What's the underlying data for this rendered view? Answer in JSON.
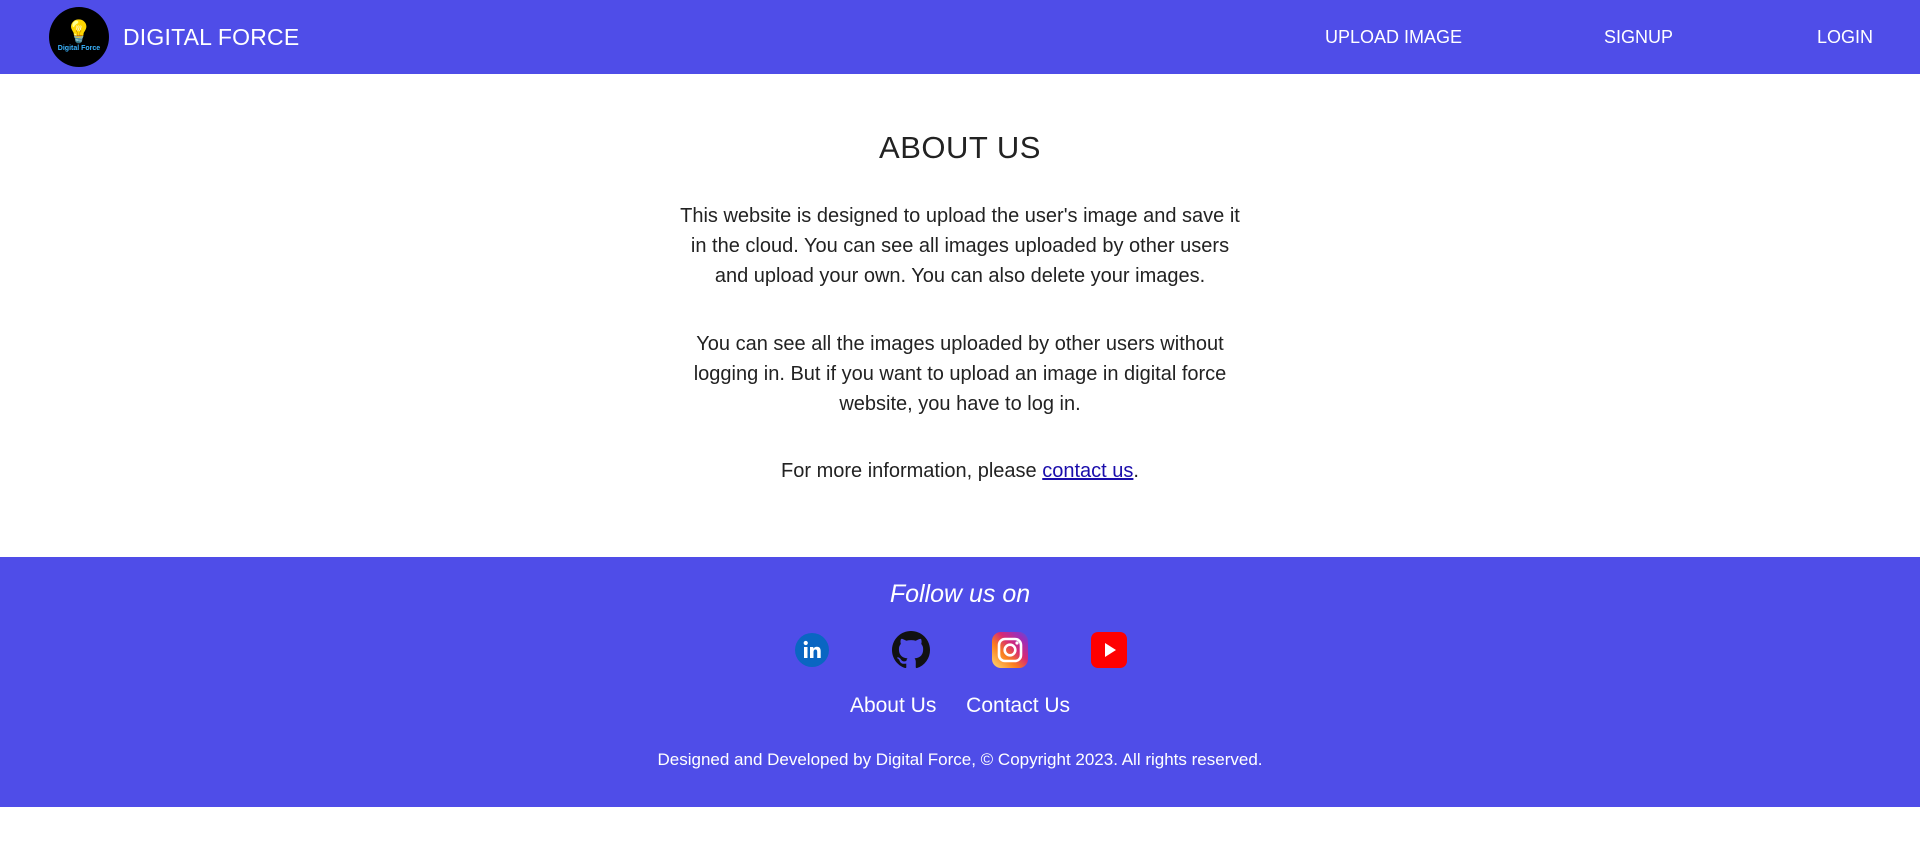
{
  "header": {
    "brand_name": "DIGITAL FORCE",
    "logo_text": "Digital Force",
    "nav": {
      "upload": "UPLOAD IMAGE",
      "signup": "SIGNUP",
      "login": "LOGIN"
    }
  },
  "main": {
    "title": "ABOUT US",
    "para1": "This website is designed to upload the user's image and save it in the cloud. You can see all images uploaded by other users and upload your own. You can also delete your images.",
    "para2": "You can see all the images uploaded by other users without logging in. But if you want to upload an image in digital force website, you have to log in.",
    "para3_prefix": "For more information, please ",
    "para3_link": "contact us",
    "para3_suffix": "."
  },
  "footer": {
    "follow": "Follow us on",
    "social": [
      "linkedin-icon",
      "github-icon",
      "instagram-icon",
      "youtube-icon"
    ],
    "links": {
      "about": "About Us",
      "contact": "Contact Us"
    },
    "copyright": "Designed and Developed by Digital Force, © Copyright 2023. All rights reserved."
  },
  "colors": {
    "primary": "#4f4de8",
    "link": "#1a0dab"
  }
}
